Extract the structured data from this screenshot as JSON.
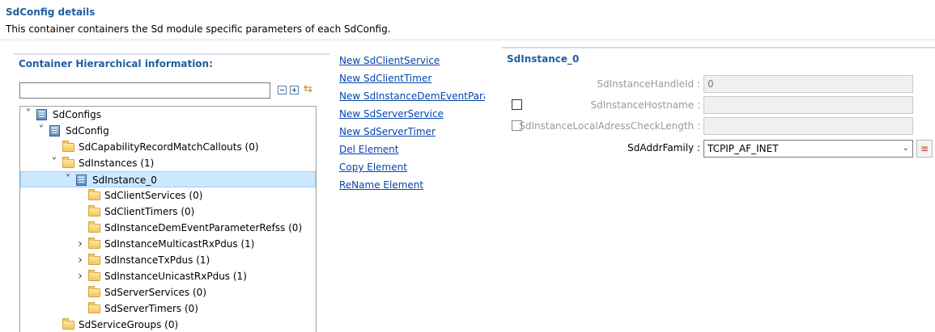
{
  "header": {
    "title": "SdConfig details",
    "description": "This container containers the Sd module specific parameters of each SdConfig."
  },
  "hierarchy": {
    "title": "Container Hierarchical information:",
    "filter_value": "",
    "tree": [
      {
        "label": "SdConfigs",
        "depth": 0,
        "expander": "open",
        "icon": "container-icon",
        "selected": false
      },
      {
        "label": "SdConfig",
        "depth": 1,
        "expander": "open",
        "icon": "container-icon",
        "selected": false
      },
      {
        "label": "SdCapabilityRecordMatchCallouts (0)",
        "depth": 2,
        "expander": "none",
        "icon": "folder-icon",
        "selected": false
      },
      {
        "label": "SdInstances (1)",
        "depth": 2,
        "expander": "open",
        "icon": "folder-icon",
        "selected": false
      },
      {
        "label": "SdInstance_0",
        "depth": 3,
        "expander": "open",
        "icon": "container-icon",
        "selected": true
      },
      {
        "label": "SdClientServices (0)",
        "depth": 4,
        "expander": "none",
        "icon": "folder-icon",
        "selected": false
      },
      {
        "label": "SdClientTimers (0)",
        "depth": 4,
        "expander": "none",
        "icon": "folder-icon",
        "selected": false
      },
      {
        "label": "SdInstanceDemEventParameterRefss (0)",
        "depth": 4,
        "expander": "none",
        "icon": "folder-icon",
        "selected": false
      },
      {
        "label": "SdInstanceMulticastRxPdus (1)",
        "depth": 4,
        "expander": "closed",
        "icon": "folder-icon",
        "selected": false
      },
      {
        "label": "SdInstanceTxPdus (1)",
        "depth": 4,
        "expander": "closed",
        "icon": "folder-icon",
        "selected": false
      },
      {
        "label": "SdInstanceUnicastRxPdus (1)",
        "depth": 4,
        "expander": "closed",
        "icon": "folder-icon",
        "selected": false
      },
      {
        "label": "SdServerServices (0)",
        "depth": 4,
        "expander": "none",
        "icon": "folder-icon",
        "selected": false
      },
      {
        "label": "SdServerTimers (0)",
        "depth": 4,
        "expander": "none",
        "icon": "folder-icon",
        "selected": false
      },
      {
        "label": "SdServiceGroups (0)",
        "depth": 2,
        "expander": "none",
        "icon": "folder-icon",
        "selected": false
      }
    ]
  },
  "actions": [
    "New SdClientService",
    "New SdClientTimer",
    "New SdInstanceDemEventParameterRefs",
    "New SdServerService",
    "New SdServerTimer",
    "Del Element",
    "Copy Element",
    "ReName Element"
  ],
  "details": {
    "title": "SdInstance_0",
    "properties": [
      {
        "label": "SdInstanceHandleId :",
        "value": "0",
        "has_checkbox": false,
        "enabled": false
      },
      {
        "label": "SdInstanceHostname :",
        "value": "",
        "has_checkbox": true,
        "enabled": false
      },
      {
        "label": "SdInstanceLocalAdressCheckLength :",
        "value": "",
        "has_checkbox": true,
        "enabled": false
      }
    ],
    "addr_family": {
      "label": "SdAddrFamily :",
      "selected": "TCPIP_AF_INET"
    }
  }
}
